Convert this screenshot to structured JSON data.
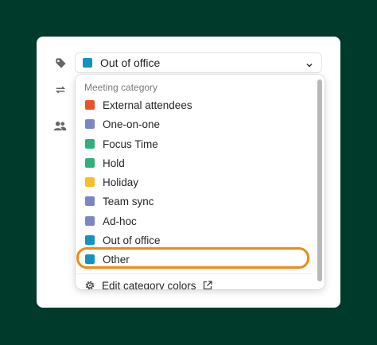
{
  "form": {
    "category_select": {
      "value": "Out of office",
      "color": "#1193c4"
    },
    "icons": [
      "tag-icon",
      "repeat-icon",
      "people-icon"
    ]
  },
  "menu": {
    "header": "Meeting category",
    "items": [
      {
        "label": "External attendees",
        "color": "#e8542a"
      },
      {
        "label": "One-on-one",
        "color": "#7b86c4"
      },
      {
        "label": "Focus Time",
        "color": "#2fb07a"
      },
      {
        "label": "Hold",
        "color": "#2fb07a"
      },
      {
        "label": "Holiday",
        "color": "#f5c027"
      },
      {
        "label": "Team sync",
        "color": "#7b86c4"
      },
      {
        "label": "Ad-hoc",
        "color": "#7b86c4"
      },
      {
        "label": "Out of office",
        "color": "#1193c4"
      },
      {
        "label": "Other",
        "color": "#1193c4"
      }
    ],
    "highlighted_item": "Other",
    "highlight_color": "#f08a17",
    "edit_label": "Edit category colors"
  },
  "colors": {
    "background": "#003a2a",
    "card": "#ffffff"
  }
}
